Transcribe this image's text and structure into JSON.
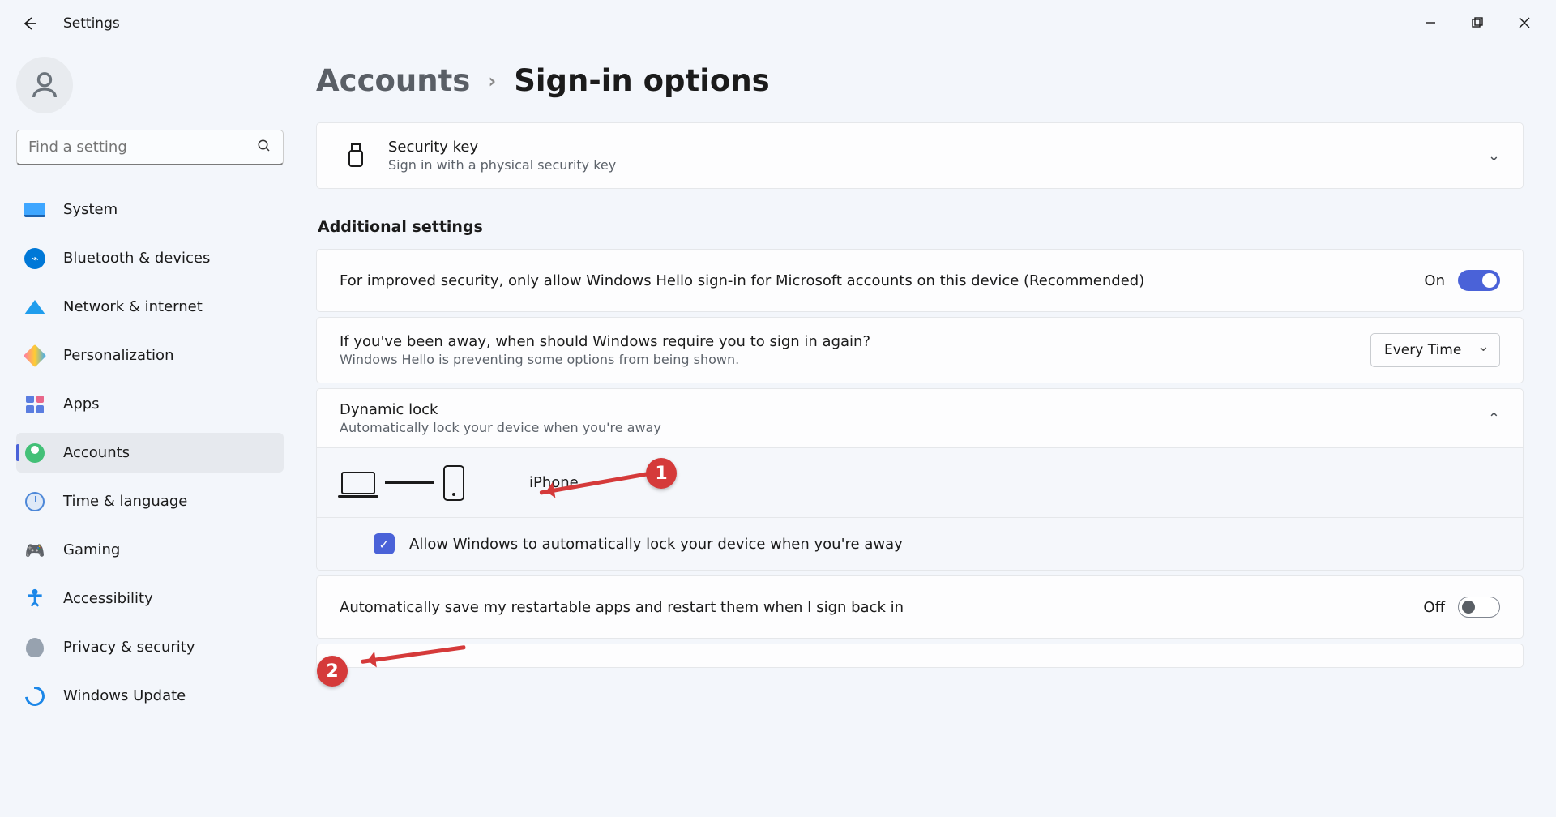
{
  "app": {
    "title": "Settings"
  },
  "search": {
    "placeholder": "Find a setting"
  },
  "nav": {
    "system": "System",
    "bluetooth": "Bluetooth & devices",
    "network": "Network & internet",
    "personalization": "Personalization",
    "apps": "Apps",
    "accounts": "Accounts",
    "time": "Time & language",
    "gaming": "Gaming",
    "accessibility": "Accessibility",
    "privacy": "Privacy & security",
    "update": "Windows Update"
  },
  "breadcrumb": {
    "parent": "Accounts",
    "separator": "›",
    "current": "Sign-in options"
  },
  "securityKey": {
    "title": "Security key",
    "sub": "Sign in with a physical security key"
  },
  "sectionLabel": "Additional settings",
  "helloOnly": {
    "title": "For improved security, only allow Windows Hello sign-in for Microsoft accounts on this device (Recommended)",
    "state": "On"
  },
  "awayReq": {
    "title": "If you've been away, when should Windows require you to sign in again?",
    "sub": "Windows Hello is preventing some options from being shown.",
    "selected": "Every Time"
  },
  "dynamicLock": {
    "title": "Dynamic lock",
    "sub": "Automatically lock your device when you're away",
    "device": "iPhone",
    "checkbox_label": "Allow Windows to automatically lock your device when you're away"
  },
  "restartApps": {
    "title": "Automatically save my restartable apps and restart them when I sign back in",
    "state": "Off"
  },
  "annotations": {
    "one": "1",
    "two": "2"
  }
}
